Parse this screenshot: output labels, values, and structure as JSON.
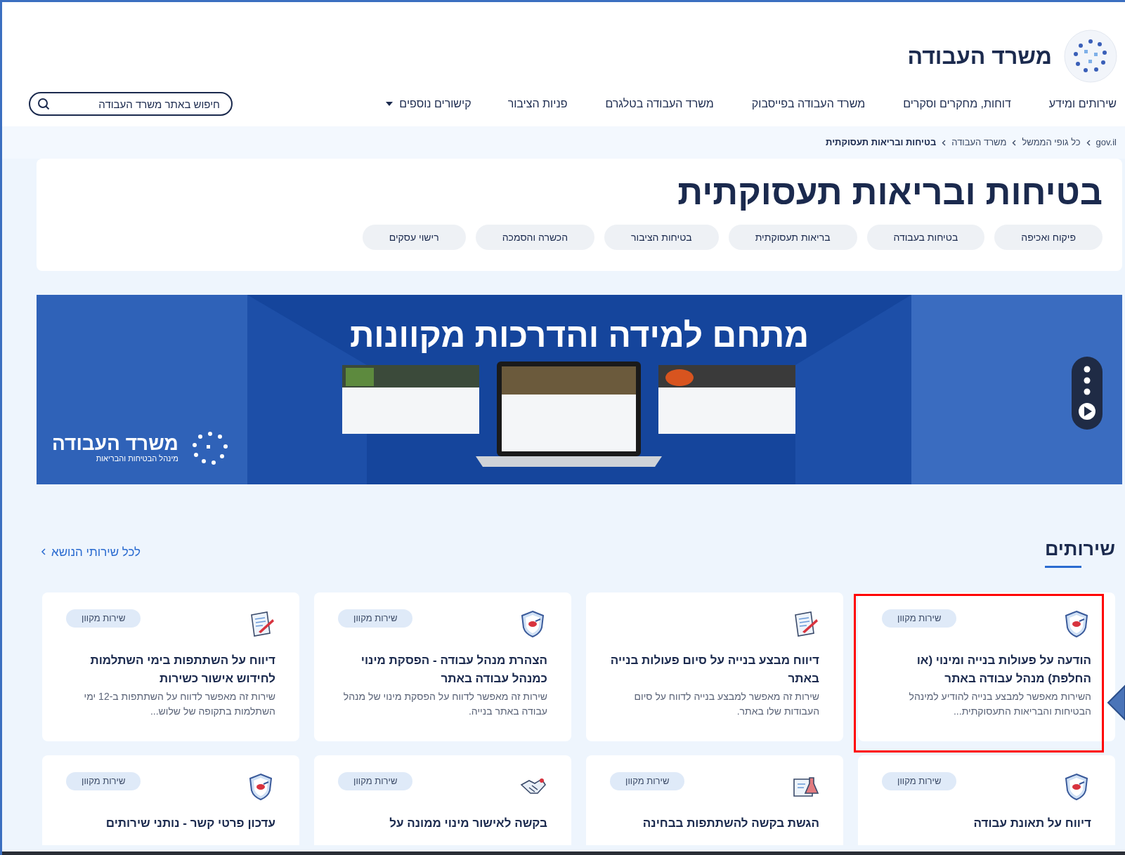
{
  "header": {
    "site_title": "משרד העבודה",
    "nav": [
      "שירותים ומידע",
      "דוחות, מחקרים וסקרים",
      "משרד העבודה בפייסבוק",
      "משרד העבודה בטלגרם",
      "פניות הציבור"
    ],
    "more_links": {
      "label": "קישורים נוספים",
      "expanded": false
    },
    "search": {
      "placeholder": "חיפוש באתר משרד העבודה"
    }
  },
  "breadcrumbs": [
    {
      "label": "gov.il",
      "current": false
    },
    {
      "label": "כל גופי הממשל",
      "current": false
    },
    {
      "label": "משרד העבודה",
      "current": false
    },
    {
      "label": "בטיחות ובריאות תעסוקתית",
      "current": true
    }
  ],
  "page_title": "בטיחות ובריאות תעסוקתית",
  "tags": [
    "פיקוח ואכיפה",
    "בטיחות בעבודה",
    "בריאות תעסוקתית",
    "בטיחות הציבור",
    "הכשרה והסמכה",
    "רישוי עסקים"
  ],
  "banner": {
    "kind": "picture",
    "title": "מתחם למידה והדרכות מקוונות",
    "logo_title": "משרד העבודה",
    "logo_subtitle": "מינהל הבטיחות והבריאות"
  },
  "services": {
    "heading": "שירותים",
    "all_link": "לכל שירותי הנושא",
    "cards": [
      {
        "kind": "shield",
        "badge": "שירות מקוון",
        "title": "הודעה על פעולות בנייה ומינוי (או החלפת) מנהל עבודה באתר",
        "description": "השירות מאפשר למבצע בנייה להודיע למינהל הבטיחות והבריאות התעסוקתית...",
        "highlighted": true
      },
      {
        "kind": "document",
        "title": "דיווח מבצע בנייה על סיום פעולות בנייה באתר",
        "description": "שירות זה מאפשר למבצע בנייה לדווח על סיום העבודות שלו באתר.",
        "highlighted": false
      },
      {
        "kind": "shield",
        "badge": "שירות מקוון",
        "title": "הצהרת מנהל עבודה - הפסקת מינוי כמנהל עבודה באתר",
        "description": "שירות זה מאפשר לדווח על הפסקת מינוי של מנהל עבודה באתר בנייה.",
        "highlighted": false
      },
      {
        "kind": "document",
        "badge": "שירות מקוון",
        "title": "דיווח על השתתפות בימי השתלמות לחידוש אישור כשירות",
        "description": "שירות זה מאפשר לדווח על השתתפות ב-12 ימי השתלמות בתקופה של שלוש...",
        "highlighted": false
      },
      {
        "kind": "shield",
        "badge": "שירות מקוון",
        "title": "דיווח על תאונת עבודה",
        "highlighted": false
      },
      {
        "kind": "certificate",
        "badge": "שירות מקוון",
        "title": "הגשת בקשה להשתתפות בבחינה",
        "highlighted": false
      },
      {
        "kind": "handshake",
        "badge": "שירות מקוון",
        "title": "בקשה לאישור מינוי ממונה על",
        "highlighted": false
      },
      {
        "kind": "shield",
        "badge": "שירות מקוון",
        "title": "עדכון פרטי קשר - נותני שירותים",
        "highlighted": false
      }
    ]
  }
}
